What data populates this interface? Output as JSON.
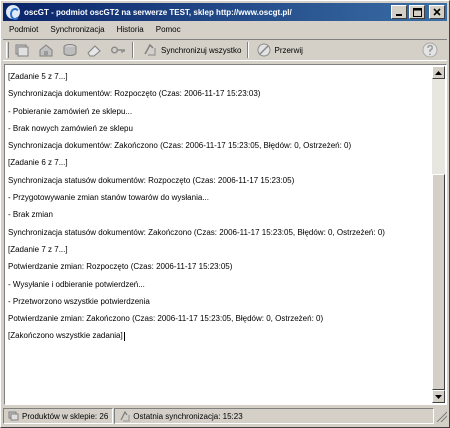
{
  "window": {
    "title": "oscGT - podmiot oscGT2 na serwerze TEST, sklep http://www.oscgt.pl/",
    "icon": "oscgt-logo-icon",
    "controls": [
      "minimize-icon",
      "maximize-icon",
      "close-icon"
    ]
  },
  "menu": {
    "items": [
      {
        "label": "Podmiot"
      },
      {
        "label": "Synchronizacja"
      },
      {
        "label": "Historia"
      },
      {
        "label": "Pomoc"
      }
    ]
  },
  "toolbar": {
    "icon_tools": [
      "products-stack-icon",
      "shop-icon",
      "database-icon",
      "eraser-icon",
      "key-icon"
    ],
    "sync_all_label": "Synchronizuj wszystko",
    "sync_all_icon": "sync-icon",
    "stop_label": "Przerwij",
    "stop_icon": "stop-icon",
    "help_icon": "help-icon"
  },
  "log": {
    "lines": [
      "[Zadanie 5 z 7...]",
      "Synchronizacja dokumentów: Rozpoczęto (Czas: 2006-11-17 15:23:03)",
      "- Pobieranie zamówień ze sklepu...",
      "- Brak nowych zamówień ze sklepu",
      "Synchronizacja dokumentów: Zakończono (Czas: 2006-11-17 15:23:05, Błędów: 0, Ostrzeżeń: 0)",
      "[Zadanie 6 z 7...]",
      "Synchronizacja statusów dokumentów: Rozpoczęto (Czas: 2006-11-17 15:23:05)",
      "- Przygotowywanie zmian stanów towarów do wysłania...",
      "- Brak zmian",
      "Synchronizacja statusów dokumentów: Zakończono (Czas: 2006-11-17 15:23:05, Błędów: 0, Ostrzeżeń: 0)",
      "[Zadanie 7 z 7...]",
      "Potwierdzanie zmian: Rozpoczęto (Czas: 2006-11-17 15:23:05)",
      "- Wysyłanie i odbieranie potwierdzeń...",
      "- Przetworzono wszystkie potwierdzenia",
      "Potwierdzanie zmian: Zakończono (Czas: 2006-11-17 15:23:05, Błędów: 0, Ostrzeżeń: 0)",
      "[Zakończono wszystkie zadania]"
    ]
  },
  "status": {
    "products_label": "Produktów w sklepie: 26",
    "last_sync_label": "Ostatnia synchronizacja: 15:23"
  }
}
